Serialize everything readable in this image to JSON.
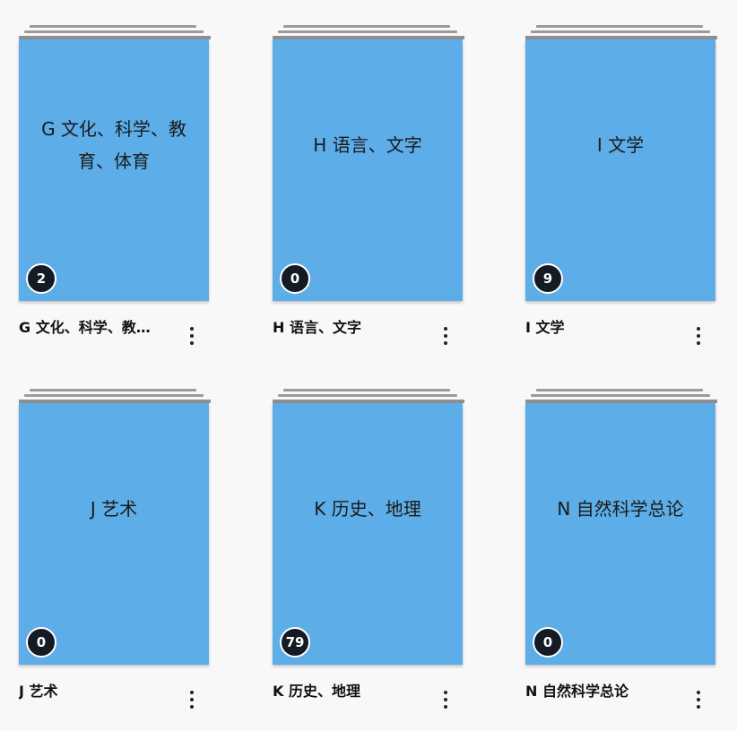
{
  "categories": [
    {
      "cover_title": "G 文化、科学、教育、体育",
      "label": "G 文化、科学、教育、体育",
      "count": "2"
    },
    {
      "cover_title": "H 语言、文字",
      "label": "H 语言、文字",
      "count": "0"
    },
    {
      "cover_title": "I 文学",
      "label": "I 文学",
      "count": "9"
    },
    {
      "cover_title": "J 艺术",
      "label": "J 艺术",
      "count": "0"
    },
    {
      "cover_title": "K 历史、地理",
      "label": "K 历史、地理",
      "count": "79"
    },
    {
      "cover_title": "N 自然科学总论",
      "label": "N 自然科学总论",
      "count": "0"
    }
  ],
  "icons": {
    "more": "more-vertical-icon"
  },
  "colors": {
    "cover": "#5dade8",
    "badge": "#141b24",
    "stack": "#9b9b9b",
    "background": "#f8f8f8"
  }
}
